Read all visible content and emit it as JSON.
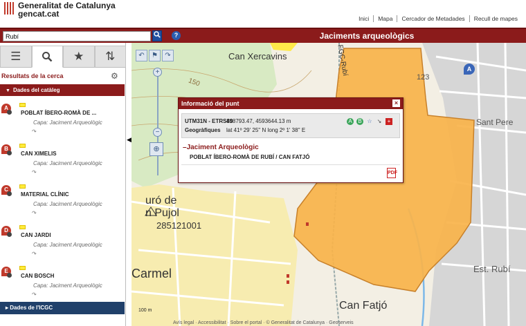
{
  "header": {
    "org_name": "Generalitat de Catalunya",
    "org_domain": "gencat.cat",
    "nav": [
      "Inici",
      "Mapa",
      "Cercador de Metadades",
      "Recull de mapes"
    ]
  },
  "toolbar": {
    "search_value": "Rubí",
    "search_icon": "search-icon",
    "help_label": "?",
    "app_title": "Jaciments arqueològics"
  },
  "sidebar": {
    "tabs": [
      {
        "name": "list-icon",
        "glyph": "☰"
      },
      {
        "name": "search-icon",
        "glyph": "⚲"
      },
      {
        "name": "star-icon",
        "glyph": "★"
      },
      {
        "name": "route-icon",
        "glyph": "⇅"
      }
    ],
    "results_title": "Resultats de la cerca",
    "section_catalog": "Dades del catàleg",
    "results": [
      {
        "letter": "A",
        "name": "POBLAT ÍBERO-ROMÀ DE ...",
        "layer": "Capa: Jaciment Arqueològic"
      },
      {
        "letter": "B",
        "name": "CAN XIMELIS",
        "layer": "Capa: Jaciment Arqueològic"
      },
      {
        "letter": "C",
        "name": "MATERIAL CLÍNIC",
        "layer": "Capa: Jaciment Arqueològic"
      },
      {
        "letter": "D",
        "name": "CAN JARDI",
        "layer": "Capa: Jaciment Arqueològic"
      },
      {
        "letter": "E",
        "name": "CAN BOSCH",
        "layer": "Capa: Jaciment Arqueològic"
      }
    ],
    "section_icgc": "Dades de l'ICGC"
  },
  "popup": {
    "title": "Informació del punt",
    "utm_label": "UTM31N - ETRS89",
    "utm_value": "418793.47, 4593644.13 m",
    "geo_label": "Geogràfiques",
    "geo_value": "lat 41º 29' 25'' N long 2º 1' 38'' E",
    "section_title": "Jaciment Arqueològic",
    "site_name": "POBLAT ÍBERO-ROMÀ DE RUBÍ / CAN FATJÓ",
    "pdf_label": "PDF"
  },
  "map": {
    "labels": {
      "can_xercavins": "Can Xercavins",
      "curo_de": "uró de",
      "n_pujol": "n Pujol",
      "elevation": "285121001",
      "carmel": "Carmel",
      "can_fatjo": "Can Fatjó",
      "sant_pere": "Sant Pere",
      "est_rubi": "Est. Rubí",
      "n150": "150",
      "n123": "123",
      "fgc": "FGC-Rubí"
    },
    "marker_a": "A",
    "scale": "100 m",
    "colors": {
      "site_polygon": "#f8b34a",
      "brand_red": "#8b1b1b",
      "icgc_blue": "#20406a"
    }
  },
  "footer": "Avís legal · Accessibilitat · Sobre el portal · © Generalitat de Catalunya · Geoserveis"
}
